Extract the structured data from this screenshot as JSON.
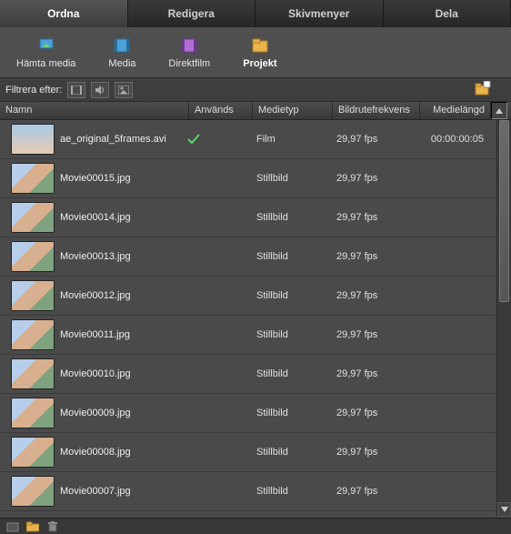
{
  "tabs": [
    {
      "label": "Ordna",
      "active": true
    },
    {
      "label": "Redigera",
      "active": false
    },
    {
      "label": "Skivmenyer",
      "active": false
    },
    {
      "label": "Dela",
      "active": false
    }
  ],
  "toolbar": [
    {
      "label": "Hämta media",
      "icon": "download",
      "active": false
    },
    {
      "label": "Media",
      "icon": "media",
      "active": false
    },
    {
      "label": "Direktfilm",
      "icon": "film",
      "active": false
    },
    {
      "label": "Projekt",
      "icon": "project",
      "active": true
    }
  ],
  "filter_label": "Filtrera efter:",
  "columns": {
    "name": "Namn",
    "used": "Används",
    "mediatype": "Medietyp",
    "fps": "Bildrutefrekvens",
    "length": "Medielängd"
  },
  "rows": [
    {
      "filename": "ae_original_5frames.avi",
      "used": true,
      "mediatype": "Film",
      "fps": "29,97 fps",
      "length": "00:00:00:05",
      "film": true
    },
    {
      "filename": "Movie00015.jpg",
      "used": false,
      "mediatype": "Stillbild",
      "fps": "29,97 fps",
      "length": "",
      "film": false
    },
    {
      "filename": "Movie00014.jpg",
      "used": false,
      "mediatype": "Stillbild",
      "fps": "29,97 fps",
      "length": "",
      "film": false
    },
    {
      "filename": "Movie00013.jpg",
      "used": false,
      "mediatype": "Stillbild",
      "fps": "29,97 fps",
      "length": "",
      "film": false
    },
    {
      "filename": "Movie00012.jpg",
      "used": false,
      "mediatype": "Stillbild",
      "fps": "29,97 fps",
      "length": "",
      "film": false
    },
    {
      "filename": "Movie00011.jpg",
      "used": false,
      "mediatype": "Stillbild",
      "fps": "29,97 fps",
      "length": "",
      "film": false
    },
    {
      "filename": "Movie00010.jpg",
      "used": false,
      "mediatype": "Stillbild",
      "fps": "29,97 fps",
      "length": "",
      "film": false
    },
    {
      "filename": "Movie00009.jpg",
      "used": false,
      "mediatype": "Stillbild",
      "fps": "29,97 fps",
      "length": "",
      "film": false
    },
    {
      "filename": "Movie00008.jpg",
      "used": false,
      "mediatype": "Stillbild",
      "fps": "29,97 fps",
      "length": "",
      "film": false
    },
    {
      "filename": "Movie00007.jpg",
      "used": false,
      "mediatype": "Stillbild",
      "fps": "29,97 fps",
      "length": "",
      "film": false
    }
  ]
}
